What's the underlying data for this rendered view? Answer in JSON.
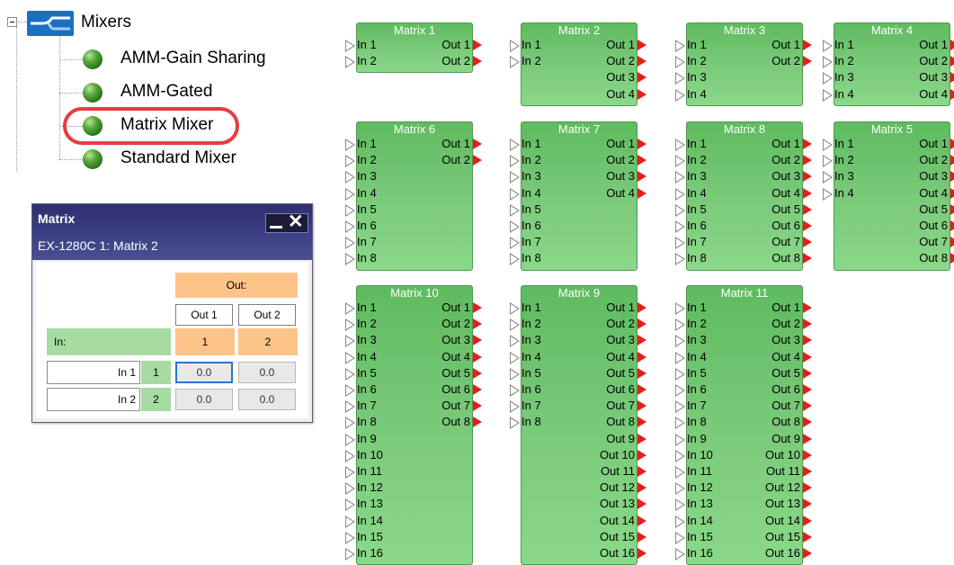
{
  "tree": {
    "root_label": "Mixers",
    "items": [
      {
        "label": "AMM-Gain Sharing"
      },
      {
        "label": "AMM-Gated"
      },
      {
        "label": "Matrix Mixer"
      },
      {
        "label": "Standard Mixer"
      }
    ],
    "highlight_color": "#e83b44"
  },
  "dialog": {
    "title": "Matrix",
    "subtitle": "EX-1280C 1: Matrix 2",
    "out_header": "Out:",
    "in_header": "In:",
    "close_glyph": "✕",
    "outputs": [
      {
        "label": "Out 1",
        "number": "1"
      },
      {
        "label": "Out 2",
        "number": "2"
      }
    ],
    "inputs": [
      {
        "name": "In 1",
        "number": "1",
        "gains": [
          "0.0",
          "0.0"
        ]
      },
      {
        "name": "In 2",
        "number": "2",
        "gains": [
          "0.0",
          "0.0"
        ]
      }
    ]
  },
  "blocks": [
    {
      "title": "Matrix 1",
      "inputs": 2,
      "outputs": 2
    },
    {
      "title": "Matrix 2",
      "inputs": 2,
      "outputs": 4
    },
    {
      "title": "Matrix 3",
      "inputs": 4,
      "outputs": 2
    },
    {
      "title": "Matrix 4",
      "inputs": 4,
      "outputs": 4
    },
    {
      "title": "Matrix 6",
      "inputs": 8,
      "outputs": 2
    },
    {
      "title": "Matrix 7",
      "inputs": 8,
      "outputs": 4
    },
    {
      "title": "Matrix 8",
      "inputs": 8,
      "outputs": 8
    },
    {
      "title": "Matrix 5",
      "inputs": 4,
      "outputs": 8
    },
    {
      "title": "Matrix 10",
      "inputs": 16,
      "outputs": 8
    },
    {
      "title": "Matrix 9",
      "inputs": 8,
      "outputs": 16
    },
    {
      "title": "Matrix 11",
      "inputs": 16,
      "outputs": 16
    }
  ],
  "colors": {
    "block_green": "#77c877",
    "output_pin": "#e81c1c",
    "dialog_title": "#3d4285",
    "out_header_bg": "#fdc48a",
    "in_header_bg": "#a6dba1"
  },
  "pin_labels": {
    "in_prefix": "In",
    "out_prefix": "Out"
  }
}
